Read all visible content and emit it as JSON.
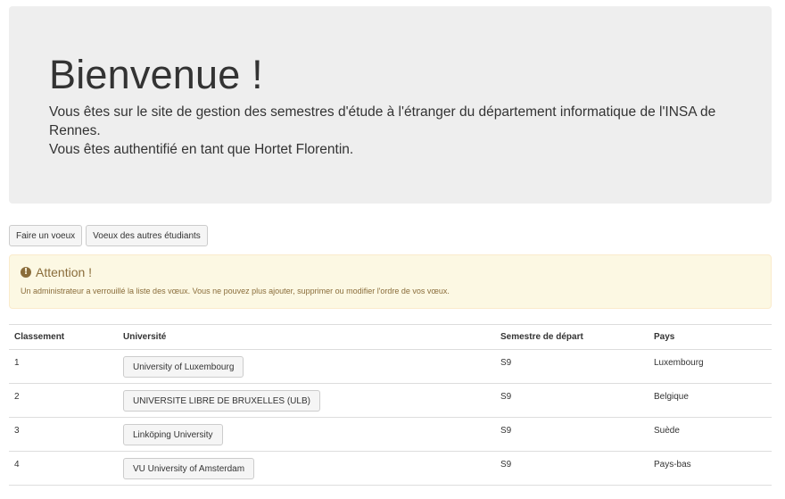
{
  "jumbotron": {
    "title": "Bienvenue !",
    "line1": "Vous êtes sur le site de gestion des semestres d'étude à l'étranger du département informatique de l'INSA de Rennes.",
    "line2": "Vous êtes authentifié en tant que Hortet Florentin."
  },
  "actions": {
    "make_wish": "Faire un voeux",
    "other_wishes": "Voeux des autres étudiants"
  },
  "alert": {
    "icon": "exclamation-circle-icon",
    "title": "Attention !",
    "message": "Un administrateur a verrouillé la liste des vœux. Vous ne pouvez plus ajouter, supprimer ou modifier l'ordre de vos vœux.",
    "colors": {
      "background": "#fcf8e3",
      "border": "#faebcc",
      "text": "#8a6d3b"
    }
  },
  "table": {
    "headers": [
      "Classement",
      "Université",
      "Semestre de départ",
      "Pays"
    ],
    "rows": [
      {
        "rank": "1",
        "university": "University of Luxembourg",
        "semester": "S9",
        "country": "Luxembourg"
      },
      {
        "rank": "2",
        "university": "UNIVERSITE LIBRE DE BRUXELLES (ULB)",
        "semester": "S9",
        "country": "Belgique"
      },
      {
        "rank": "3",
        "university": "Linköping University",
        "semester": "S9",
        "country": "Suède"
      },
      {
        "rank": "4",
        "university": "VU University of Amsterdam",
        "semester": "S9",
        "country": "Pays-bas"
      }
    ]
  }
}
